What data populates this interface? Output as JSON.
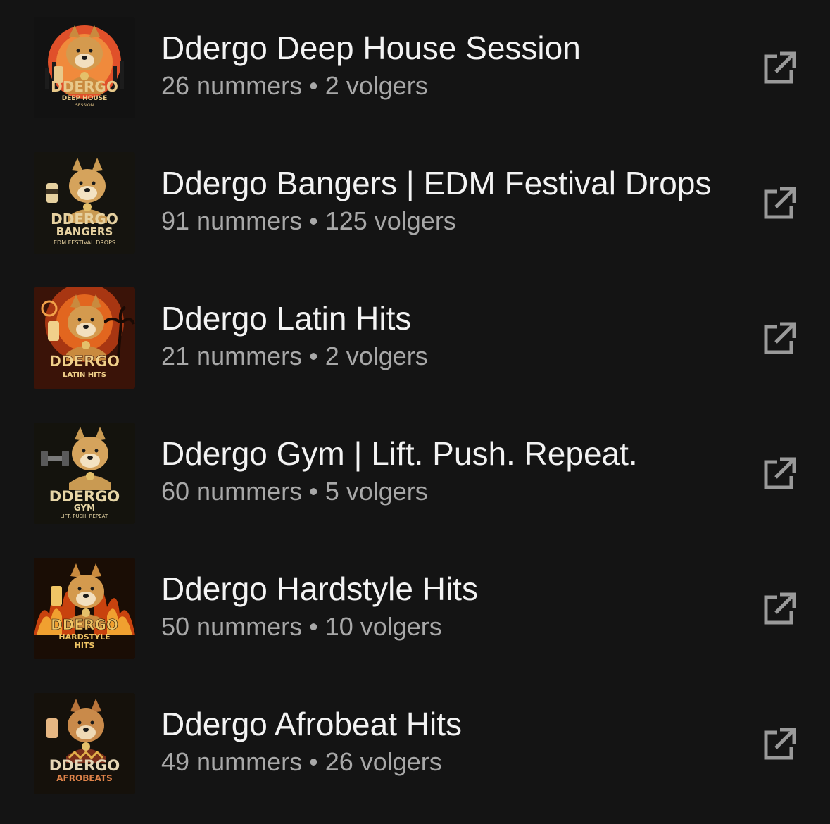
{
  "separator": "•",
  "playlists": [
    {
      "title": "Ddergo Deep House Session",
      "tracks": "26 nummers",
      "followers": "2 volgers",
      "cover": {
        "brand": "DDERGO",
        "line1": "DEEP HOUSE",
        "line2": "SESSION",
        "bg": "#121212",
        "accent": "#e0502a",
        "text_color": "#e8c98a"
      }
    },
    {
      "title": "Ddergo Bangers | EDM Festival Drops",
      "tracks": "91 nummers",
      "followers": "125 volgers",
      "cover": {
        "brand": "DDERGO",
        "line1": "BANGERS",
        "line2": "EDM FESTIVAL DROPS",
        "bg": "#15140f",
        "accent": "#2a2618",
        "text_color": "#e6d1a0"
      }
    },
    {
      "title": "Ddergo Latin Hits",
      "tracks": "21 nummers",
      "followers": "2 volgers",
      "cover": {
        "brand": "DDERGO",
        "line1": "LATIN HITS",
        "line2": "",
        "bg": "#3a1308",
        "accent": "#e2661f",
        "text_color": "#f1d08a"
      }
    },
    {
      "title": "Ddergo Gym | Lift. Push. Repeat.",
      "tracks": "60 nummers",
      "followers": "5 volgers",
      "cover": {
        "brand": "DDERGO",
        "line1": "GYM",
        "line2": "LIFT. PUSH. REPEAT.",
        "bg": "#14130d",
        "accent": "#2b2617",
        "text_color": "#e7d6a6"
      }
    },
    {
      "title": "Ddergo Hardstyle Hits",
      "tracks": "50 nummers",
      "followers": "10 volgers",
      "cover": {
        "brand": "DDERGO",
        "line1": "HARDSTYLE",
        "line2": "HITS",
        "bg": "#1a0d05",
        "accent": "#e86a15",
        "text_color": "#f0c565"
      }
    },
    {
      "title": "Ddergo Afrobeat Hits",
      "tracks": "49 nummers",
      "followers": "26 volgers",
      "cover": {
        "brand": "DDERGO",
        "line1": "AFROBEATS",
        "line2": "",
        "bg": "#15110b",
        "accent": "#3a2a14",
        "text_color": "#e6b783"
      }
    }
  ],
  "share_icon": "external-link-icon",
  "colors": {
    "background": "#141414",
    "title": "#f3f3f3",
    "meta": "#a8a8a8",
    "icon": "#9a9a9a"
  }
}
